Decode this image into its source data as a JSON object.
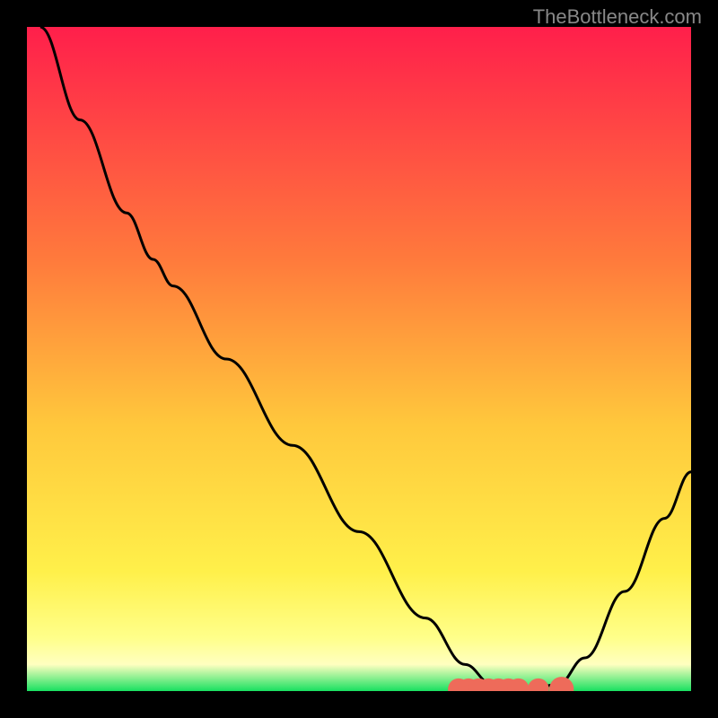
{
  "watermark": "TheBottleneck.com",
  "chart_data": {
    "type": "line",
    "title": "",
    "xlabel": "",
    "ylabel": "",
    "xlim": [
      0,
      100
    ],
    "ylim": [
      0,
      100
    ],
    "gradient_stops": [
      {
        "offset": 0,
        "color": "#ff1f4b"
      },
      {
        "offset": 35,
        "color": "#ff7a3c"
      },
      {
        "offset": 60,
        "color": "#ffc83c"
      },
      {
        "offset": 82,
        "color": "#fff04a"
      },
      {
        "offset": 92,
        "color": "#ffff8a"
      },
      {
        "offset": 96,
        "color": "#ffffc0"
      },
      {
        "offset": 100,
        "color": "#18e060"
      }
    ],
    "series": [
      {
        "name": "bottleneck-curve",
        "color": "#000000",
        "points": [
          {
            "x": 2,
            "y": 100
          },
          {
            "x": 8,
            "y": 86
          },
          {
            "x": 15,
            "y": 72
          },
          {
            "x": 19,
            "y": 65
          },
          {
            "x": 22,
            "y": 61
          },
          {
            "x": 30,
            "y": 50
          },
          {
            "x": 40,
            "y": 37
          },
          {
            "x": 50,
            "y": 24
          },
          {
            "x": 60,
            "y": 11
          },
          {
            "x": 66,
            "y": 4
          },
          {
            "x": 70,
            "y": 1
          },
          {
            "x": 75,
            "y": 0
          },
          {
            "x": 80,
            "y": 1
          },
          {
            "x": 84,
            "y": 5
          },
          {
            "x": 90,
            "y": 15
          },
          {
            "x": 96,
            "y": 26
          },
          {
            "x": 100,
            "y": 33
          }
        ]
      }
    ],
    "markers": [
      {
        "x": 65,
        "y": 0.3,
        "r": 1.0,
        "color": "#ee6b5a"
      },
      {
        "x": 66.5,
        "y": 0.3,
        "r": 1.0,
        "color": "#ee6b5a"
      },
      {
        "x": 68,
        "y": 0.3,
        "r": 1.0,
        "color": "#ee6b5a"
      },
      {
        "x": 69.5,
        "y": 0.3,
        "r": 1.0,
        "color": "#ee6b5a"
      },
      {
        "x": 71,
        "y": 0.3,
        "r": 1.0,
        "color": "#ee6b5a"
      },
      {
        "x": 72.5,
        "y": 0.3,
        "r": 1.0,
        "color": "#ee6b5a"
      },
      {
        "x": 74,
        "y": 0.3,
        "r": 1.0,
        "color": "#ee6b5a"
      },
      {
        "x": 77,
        "y": 0.3,
        "r": 1.0,
        "color": "#ee6b5a"
      },
      {
        "x": 80.5,
        "y": 0.3,
        "r": 1.2,
        "color": "#ee6b5a"
      }
    ]
  }
}
